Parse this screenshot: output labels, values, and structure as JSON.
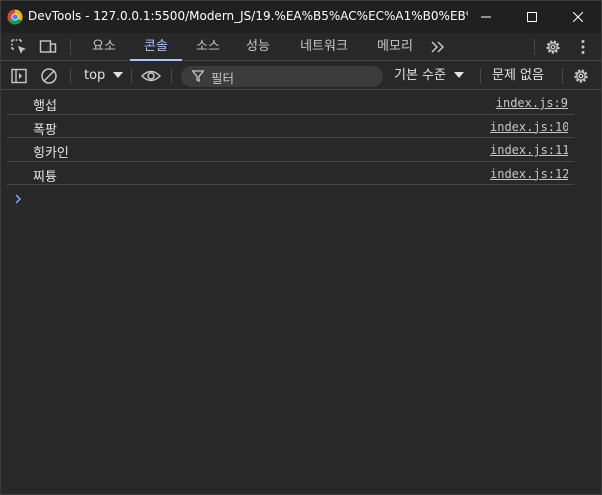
{
  "window": {
    "title": "DevTools - 127.0.0.1:5500/Modern_JS/19.%EA%B5%AC%EC%A1%B0%EB%B6%..."
  },
  "tabs": [
    {
      "label": "요소",
      "active": false
    },
    {
      "label": "콘솔",
      "active": true
    },
    {
      "label": "소스",
      "active": false
    },
    {
      "label": "성능",
      "active": false
    },
    {
      "label": "네트워크",
      "active": false
    },
    {
      "label": "메모리",
      "active": false
    }
  ],
  "console_toolbar": {
    "context": "top",
    "filter_placeholder": "필터",
    "levels": "기본 수준",
    "issues": "문제 없음"
  },
  "messages": [
    {
      "text": "행섭",
      "source": "index.js:9"
    },
    {
      "text": "폭팡",
      "source": "index.js:10"
    },
    {
      "text": "힝카인",
      "source": "index.js:11"
    },
    {
      "text": "찌튱",
      "source": "index.js:12"
    }
  ],
  "colors": {
    "background": "#282828",
    "titlebar": "#202020",
    "accent": "#a8c7fa",
    "text": "#e3e3e3",
    "divider": "#474747"
  },
  "icons": [
    "chrome-logo-icon",
    "inspect-element-icon",
    "device-toolbar-icon",
    "more-tabs-icon",
    "settings-icon",
    "kebab-menu-icon",
    "sidebar-toggle-icon",
    "clear-console-icon",
    "eye-icon",
    "filter-icon",
    "console-settings-icon",
    "prompt-chevron-icon"
  ]
}
